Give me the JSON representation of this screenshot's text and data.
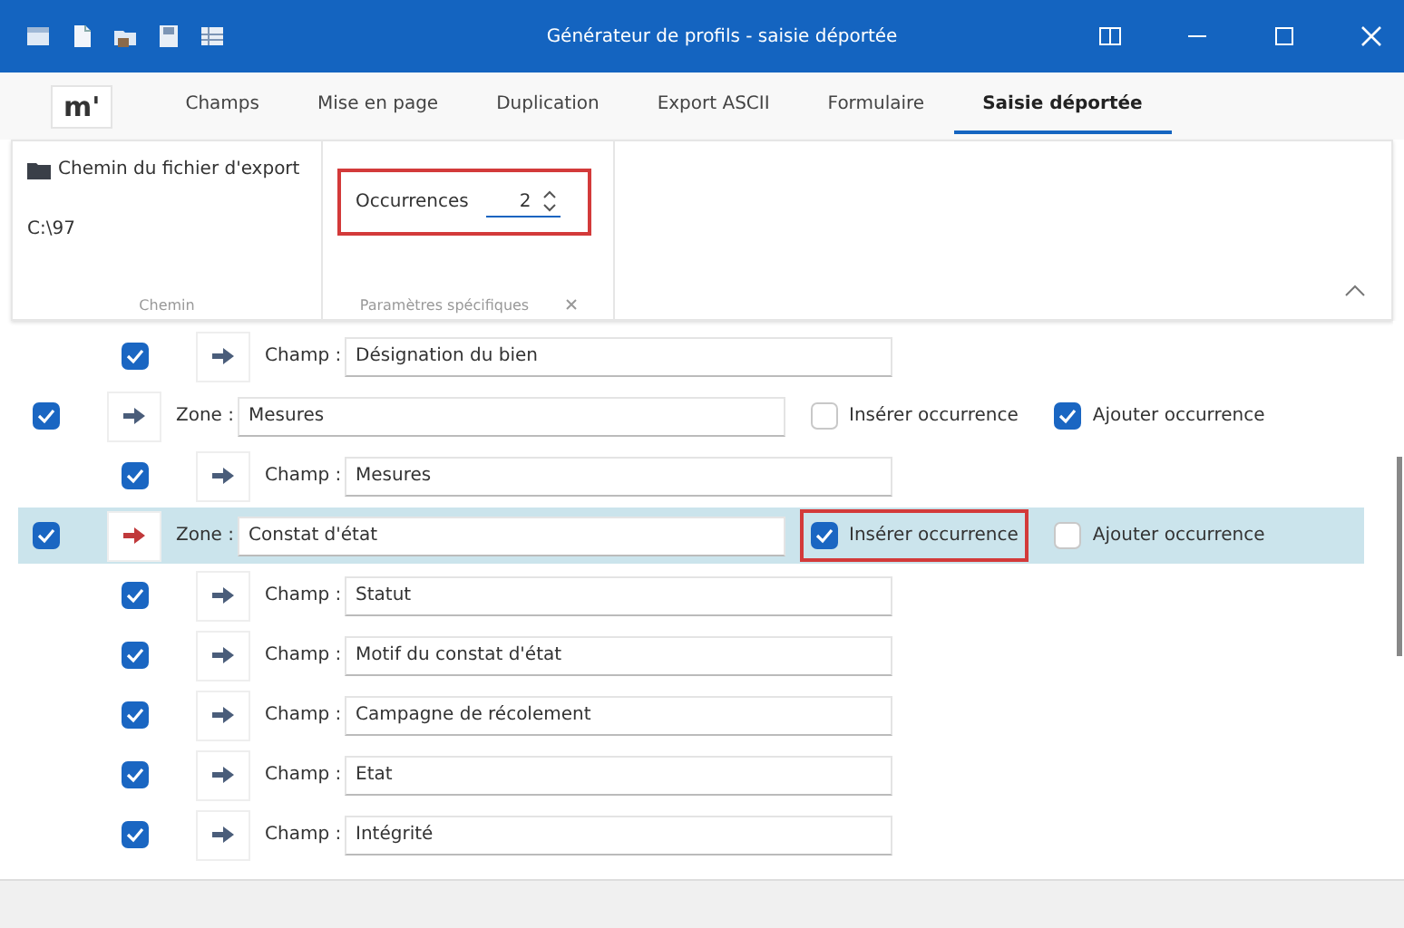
{
  "window": {
    "title": "Générateur de profils - saisie déportée"
  },
  "logo": "m'",
  "tabs": [
    {
      "label": "Champs",
      "selected": false
    },
    {
      "label": "Mise en page",
      "selected": false
    },
    {
      "label": "Duplication",
      "selected": false
    },
    {
      "label": "Export ASCII",
      "selected": false
    },
    {
      "label": "Formulaire",
      "selected": false
    },
    {
      "label": "Saisie déportée",
      "selected": true
    }
  ],
  "ribbon": {
    "groups": [
      {
        "kind": "path",
        "label": "Chemin",
        "button": "Chemin du fichier d'export",
        "value": "C:\\97"
      },
      {
        "kind": "params",
        "label": "Paramètres spécifiques",
        "field_label": "Occurrences",
        "value": "2",
        "highlighted": true
      }
    ]
  },
  "rows": [
    {
      "kind": "champ",
      "checked": true,
      "label": "Champ :",
      "value": "Désignation du bien",
      "selected": false
    },
    {
      "kind": "zone",
      "checked": true,
      "label": "Zone :",
      "value": "Mesures",
      "selected": false,
      "insert": {
        "label": "Insérer occurrence",
        "checked": false,
        "highlighted": false
      },
      "add": {
        "label": "Ajouter occurrence",
        "checked": true
      }
    },
    {
      "kind": "champ",
      "checked": true,
      "label": "Champ :",
      "value": "Mesures",
      "selected": false
    },
    {
      "kind": "zone",
      "checked": true,
      "label": "Zone :",
      "value": "Constat d'état",
      "selected": true,
      "insert": {
        "label": "Insérer occurrence",
        "checked": true,
        "highlighted": true
      },
      "add": {
        "label": "Ajouter occurrence",
        "checked": false
      }
    },
    {
      "kind": "champ",
      "checked": true,
      "label": "Champ :",
      "value": "Statut",
      "selected": false
    },
    {
      "kind": "champ",
      "checked": true,
      "label": "Champ :",
      "value": "Motif du constat d'état",
      "selected": false
    },
    {
      "kind": "champ",
      "checked": true,
      "label": "Champ :",
      "value": "Campagne de récolement",
      "selected": false
    },
    {
      "kind": "champ",
      "checked": true,
      "label": "Champ :",
      "value": "Etat",
      "selected": false
    },
    {
      "kind": "champ",
      "checked": true,
      "label": "Champ :",
      "value": "Intégrité",
      "selected": false
    }
  ]
}
